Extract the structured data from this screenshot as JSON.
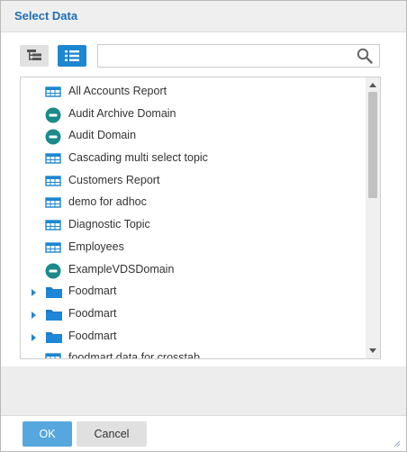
{
  "dialog": {
    "title": "Select Data",
    "accent_color": "#1d86d0"
  },
  "toolbar": {
    "tree_view_icon": "tree-view-icon",
    "list_view_icon": "list-view-icon"
  },
  "search": {
    "value": "",
    "placeholder": "",
    "icon": "search-icon"
  },
  "items": [
    {
      "label": "All Accounts Report",
      "icon": "report-table-icon",
      "expandable": false
    },
    {
      "label": "Audit Archive Domain",
      "icon": "domain-icon",
      "expandable": false
    },
    {
      "label": "Audit Domain",
      "icon": "domain-icon",
      "expandable": false
    },
    {
      "label": "Cascading multi select topic",
      "icon": "report-table-icon",
      "expandable": false
    },
    {
      "label": "Customers Report",
      "icon": "report-table-icon",
      "expandable": false
    },
    {
      "label": "demo for adhoc",
      "icon": "report-table-icon",
      "expandable": false
    },
    {
      "label": "Diagnostic Topic",
      "icon": "report-table-icon",
      "expandable": false
    },
    {
      "label": "Employees",
      "icon": "report-table-icon",
      "expandable": false
    },
    {
      "label": "ExampleVDSDomain",
      "icon": "domain-icon",
      "expandable": false
    },
    {
      "label": "Foodmart",
      "icon": "folder-icon",
      "expandable": true
    },
    {
      "label": "Foodmart",
      "icon": "folder-icon",
      "expandable": true
    },
    {
      "label": "Foodmart",
      "icon": "folder-icon",
      "expandable": true
    },
    {
      "label": "foodmart data for crosstab",
      "icon": "report-table-icon",
      "expandable": false
    }
  ],
  "footer": {
    "ok_label": "OK",
    "cancel_label": "Cancel"
  }
}
